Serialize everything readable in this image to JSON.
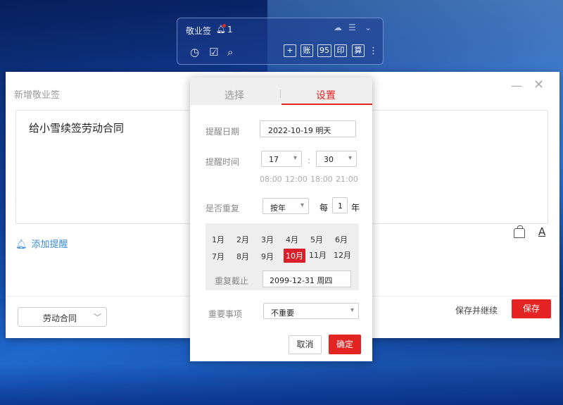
{
  "widget": {
    "title": "敬业签",
    "badge_count": "1",
    "buttons": {
      "add": "+",
      "account": "账",
      "n95": "95",
      "print": "印",
      "calc": "算"
    }
  },
  "dialog": {
    "title": "新增敬业签",
    "content": "给小雪续签劳动合同",
    "add_reminder": "添加提醒",
    "category": "劳动合同",
    "save_continue": "保存并继续",
    "save": "保存"
  },
  "popup": {
    "tabs": {
      "select": "选择",
      "settings": "设置"
    },
    "date_label": "提醒日期",
    "date_value": "2022-10-19  明天",
    "time_label": "提醒时间",
    "hour": "17",
    "minute": "30",
    "colon": ":",
    "quick_times": [
      "08:00",
      "12:00",
      "18:00",
      "21:00"
    ],
    "repeat_label": "是否重复",
    "repeat_mode": "按年",
    "every_label": "每",
    "every_value": "1",
    "every_unit": "年",
    "months": [
      "1月",
      "2月",
      "3月",
      "4月",
      "5月",
      "6月",
      "7月",
      "8月",
      "9月",
      "10月",
      "11月",
      "12月"
    ],
    "selected_month": "10月",
    "end_label": "重复截止",
    "end_value": "2099-12-31  周四",
    "importance_label": "重要事项",
    "importance_value": "不重要",
    "cancel": "取消",
    "ok": "确定"
  },
  "colors": {
    "accent": "#e42323",
    "link": "#3c8cd8"
  }
}
